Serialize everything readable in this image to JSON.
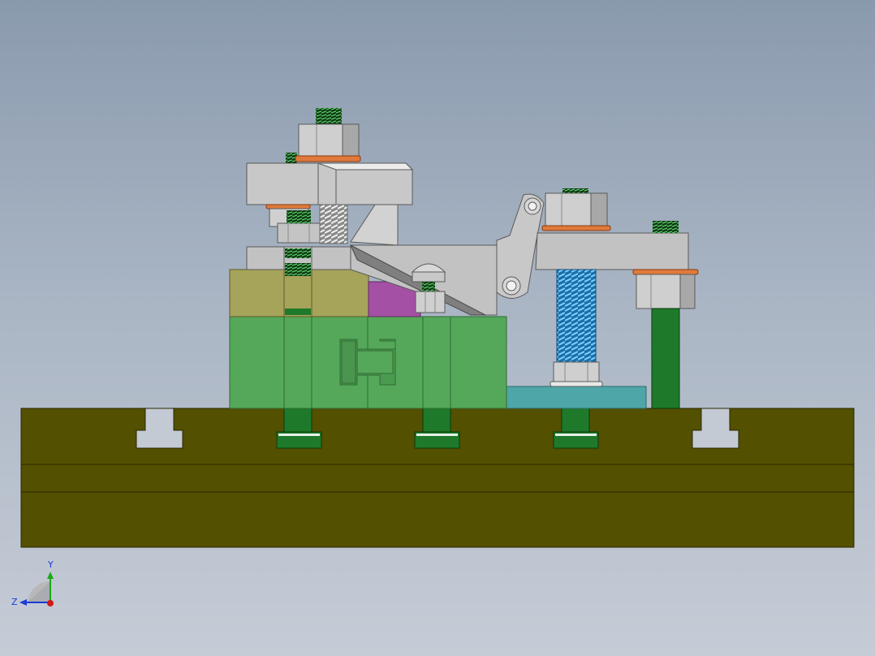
{
  "triad": {
    "y_label": "Y",
    "z_label": "Z"
  },
  "colors": {
    "base_olive": "#535000",
    "block_green": "#55a85a",
    "block_khaki": "#a6a35a",
    "clamp_gray": "#c2c2c2",
    "spring_blue": "#2a8ec8",
    "pin_green": "#1e7a2a",
    "magenta": "#a450a4",
    "teal": "#4fa6a8",
    "washer_orange": "#e07a3a"
  }
}
